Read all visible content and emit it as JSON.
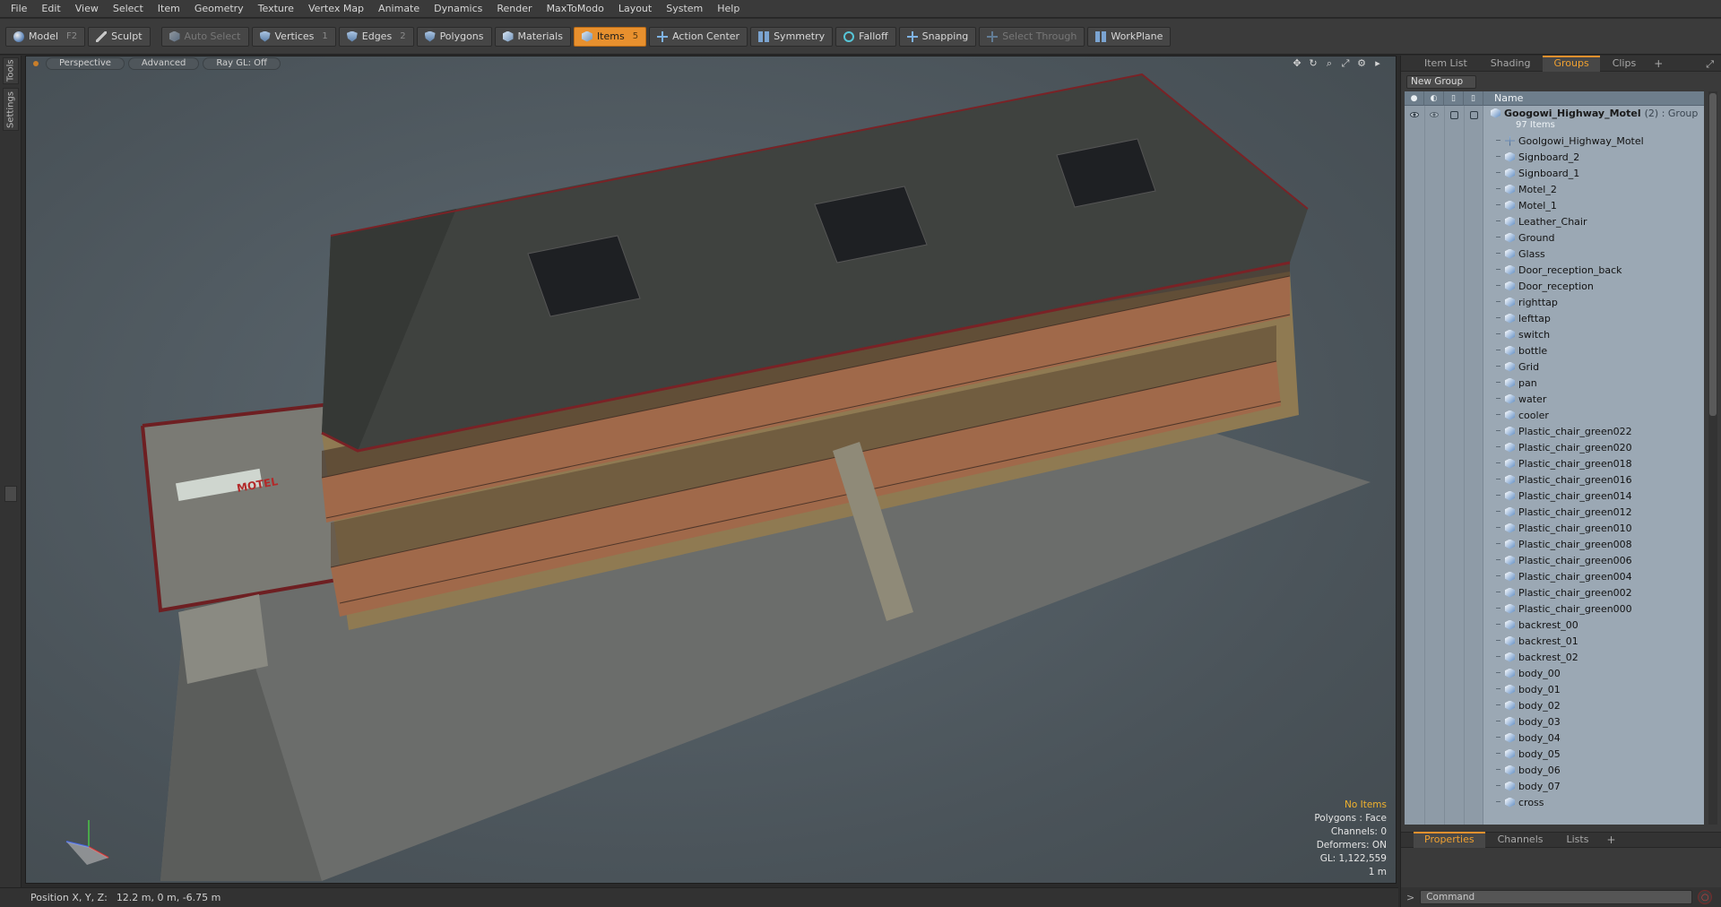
{
  "menubar": [
    "File",
    "Edit",
    "View",
    "Select",
    "Item",
    "Geometry",
    "Texture",
    "Vertex Map",
    "Animate",
    "Dynamics",
    "Render",
    "MaxToModo",
    "Layout",
    "System",
    "Help"
  ],
  "toolbar": {
    "model": "Model",
    "model_key": "F2",
    "sculpt": "Sculpt",
    "auto_select": "Auto Select",
    "vertices": "Vertices",
    "vertices_key": "1",
    "edges": "Edges",
    "edges_key": "2",
    "polygons": "Polygons",
    "materials": "Materials",
    "items": "Items",
    "items_key": "5",
    "action_center": "Action Center",
    "symmetry": "Symmetry",
    "falloff": "Falloff",
    "snapping": "Snapping",
    "select_through": "Select Through",
    "workplane": "WorkPlane"
  },
  "left_strip": {
    "tools": "Tools",
    "settings": "Settings"
  },
  "viewport": {
    "view": "Perspective",
    "shading": "Advanced",
    "raygl": "Ray GL: Off",
    "hud": {
      "no_items": "No Items",
      "polygons": "Polygons : Face",
      "channels": "Channels: 0",
      "deformers": "Deformers: ON",
      "gl": "GL: 1,122,559",
      "scale": "1 m"
    },
    "sign_text": "MOTEL"
  },
  "status": {
    "label": "Position X, Y, Z:",
    "value": "12.2 m, 0 m, -6.75 m"
  },
  "right_panel": {
    "tabs": [
      "Item List",
      "Shading",
      "Groups",
      "Clips"
    ],
    "active_tab": "Groups",
    "new_group": "New Group",
    "name_col": "Name",
    "group": {
      "name": "Googowi_Highway_Motel",
      "suffix": "(2) : Group",
      "count": "97 Items"
    },
    "items": [
      "Goolgowi_Highway_Motel",
      "Signboard_2",
      "Signboard_1",
      "Motel_2",
      "Motel_1",
      "Leather_Chair",
      "Ground",
      "Glass",
      "Door_reception_back",
      "Door_reception",
      "righttap",
      "lefttap",
      "switch",
      "bottle",
      "Grid",
      "pan",
      "water",
      "cooler",
      "Plastic_chair_green022",
      "Plastic_chair_green020",
      "Plastic_chair_green018",
      "Plastic_chair_green016",
      "Plastic_chair_green014",
      "Plastic_chair_green012",
      "Plastic_chair_green010",
      "Plastic_chair_green008",
      "Plastic_chair_green006",
      "Plastic_chair_green004",
      "Plastic_chair_green002",
      "Plastic_chair_green000",
      "backrest_00",
      "backrest_01",
      "backrest_02",
      "body_00",
      "body_01",
      "body_02",
      "body_03",
      "body_04",
      "body_05",
      "body_06",
      "body_07",
      "cross"
    ],
    "bottom_tabs": [
      "Properties",
      "Channels",
      "Lists"
    ],
    "active_bottom_tab": "Properties",
    "command_placeholder": "Command",
    "command_prompt": ">"
  }
}
